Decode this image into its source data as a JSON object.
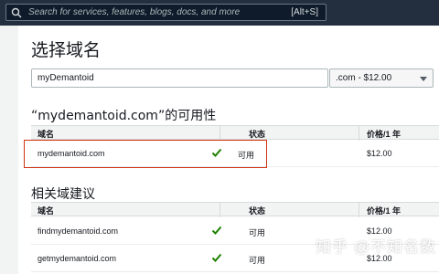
{
  "topbar": {
    "search_placeholder": "Search for services, features, blogs, docs, and more",
    "shortcut": "[Alt+S]"
  },
  "main": {
    "title": "选择域名",
    "domain_input_value": "myDemantoid",
    "tld_select_value": ".com - $12.00",
    "availability_heading": "“mydemantoid.com”的可用性",
    "columns": {
      "domain": "域名",
      "status": "状态",
      "price": "价格/1 年"
    },
    "availability_row": {
      "domain": "mydemantoid.com",
      "status": "可用",
      "price": "$12.00"
    },
    "suggestions_heading": "相关域建议",
    "suggestions": [
      {
        "domain": "findmydemantoid.com",
        "status": "可用",
        "price": "$12.00"
      },
      {
        "domain": "getmydemantoid.com",
        "status": "可用",
        "price": "$12.00"
      }
    ]
  },
  "watermark": "知乎 @不知名数",
  "colors": {
    "available_check": "#1d8102",
    "highlight_border": "#d13212"
  }
}
